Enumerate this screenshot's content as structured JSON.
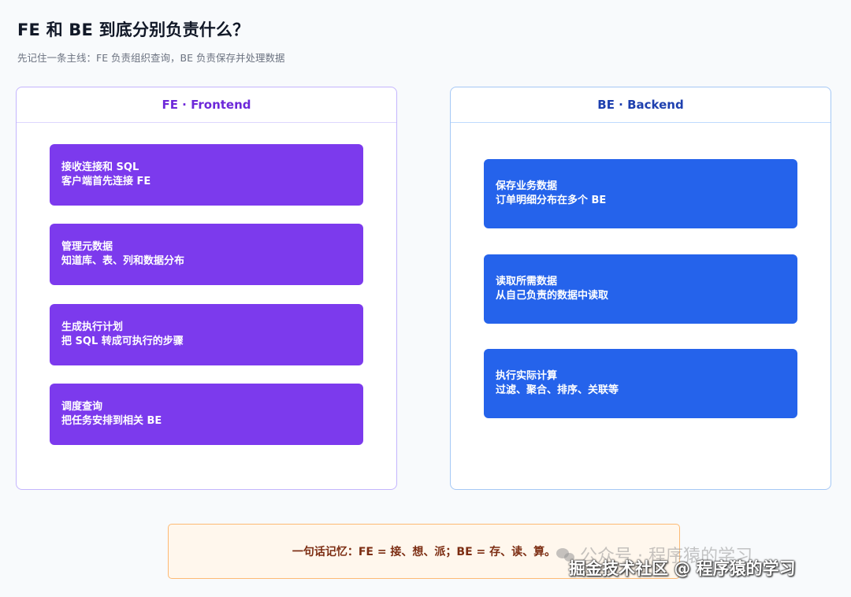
{
  "title": "FE 和 BE 到底分别负责什么？",
  "subtitle": "先记住一条主线：FE 负责组织查询，BE 负责保存并处理数据",
  "fe_panel": {
    "header": "FE · Frontend",
    "cards": [
      {
        "title": "接收连接和 SQL",
        "desc": "客户端首先连接 FE"
      },
      {
        "title": "管理元数据",
        "desc": "知道库、表、列和数据分布"
      },
      {
        "title": "生成执行计划",
        "desc": "把 SQL 转成可执行的步骤"
      },
      {
        "title": "调度查询",
        "desc": "把任务安排到相关 BE"
      }
    ]
  },
  "be_panel": {
    "header": "BE · Backend",
    "cards": [
      {
        "title": "保存业务数据",
        "desc": "订单明细分布在多个 BE"
      },
      {
        "title": "读取所需数据",
        "desc": "从自己负责的数据中读取"
      },
      {
        "title": "执行实际计算",
        "desc": "过滤、聚合、排序、关联等"
      }
    ]
  },
  "summary": "一句话记忆：FE = 接、想、派；BE = 存、读、算。",
  "watermark": {
    "wechat": "公众号 · 程序猿的学习",
    "juejin": "掘金技术社区 @ 程序猿的学习",
    "icon": "wechat-icon"
  },
  "colors": {
    "fe_card": "#7c3aed",
    "be_card": "#2563eb",
    "summary_bg": "#fff7ed",
    "summary_border": "#fdba74"
  }
}
